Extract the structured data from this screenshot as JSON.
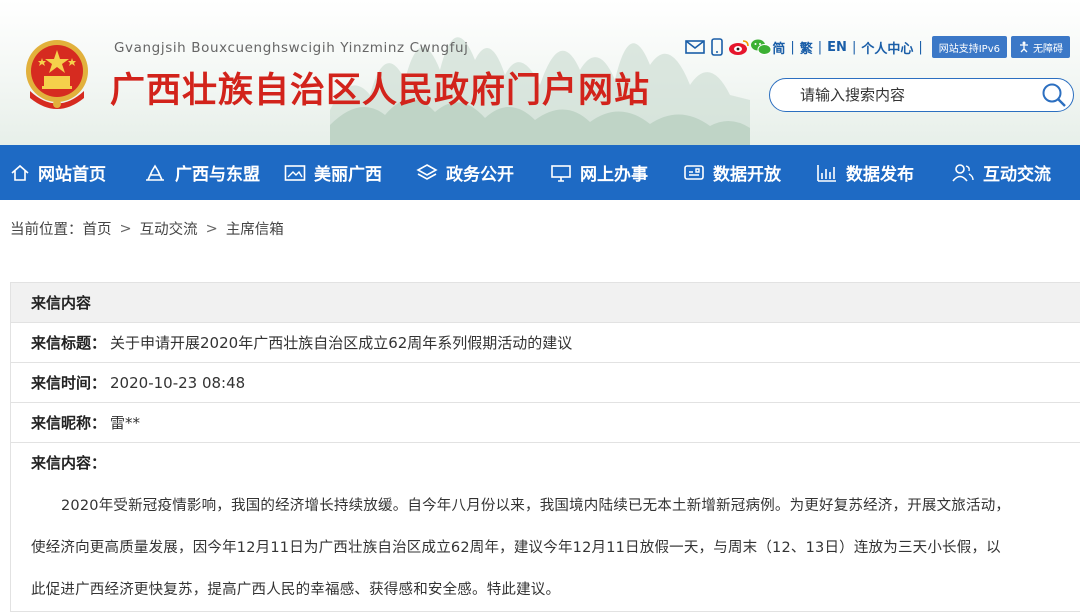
{
  "site": {
    "pinyin": "Gvangjsih Bouxcuenghswcigih Yinzminz Cwngfuj",
    "title": "广西壮族自治区人民政府门户网站"
  },
  "toolbar": {
    "simplified": "简",
    "traditional": "繁",
    "english": "EN",
    "user_center": "个人中心",
    "ipv6": "网站支持IPv6",
    "accessible": "无障碍"
  },
  "search": {
    "placeholder": "请输入搜索内容"
  },
  "nav": {
    "items": [
      {
        "label": "网站首页",
        "icon": "home-icon"
      },
      {
        "label": "广西与东盟",
        "icon": "landmark-icon"
      },
      {
        "label": "美丽广西",
        "icon": "picture-icon"
      },
      {
        "label": "政务公开",
        "icon": "layers-icon"
      },
      {
        "label": "网上办事",
        "icon": "monitor-icon"
      },
      {
        "label": "数据开放",
        "icon": "database-icon"
      },
      {
        "label": "数据发布",
        "icon": "bar-chart-icon"
      },
      {
        "label": "互动交流",
        "icon": "users-icon"
      }
    ]
  },
  "breadcrumb": {
    "prefix": "当前位置：",
    "items": [
      "首页",
      "互动交流",
      "主席信箱"
    ],
    "separator": ">"
  },
  "letter": {
    "section_title": "来信内容",
    "subject_label": "来信标题：",
    "subject": "关于申请开展2020年广西壮族自治区成立62周年系列假期活动的建议",
    "time_label": "来信时间：",
    "time": "2020-10-23 08:48",
    "nickname_label": "来信昵称：",
    "nickname": "雷**",
    "content_label": "来信内容：",
    "content": "2020年受新冠疫情影响，我国的经济增长持续放缓。自今年八月份以来，我国境内陆续已无本土新增新冠病例。为更好复苏经济，开展文旅活动，使经济向更高质量发展，因今年12月11日为广西壮族自治区成立62周年，建议今年12月11日放假一天，与周末（12、13日）连放为三天小长假，以此促进广西经济更快复苏，提高广西人民的幸福感、获得感和安全感。特此建议。"
  },
  "colors": {
    "brand_red": "#d2231b",
    "nav_blue": "#1e6ac4",
    "link_blue": "#1a5ea8"
  }
}
